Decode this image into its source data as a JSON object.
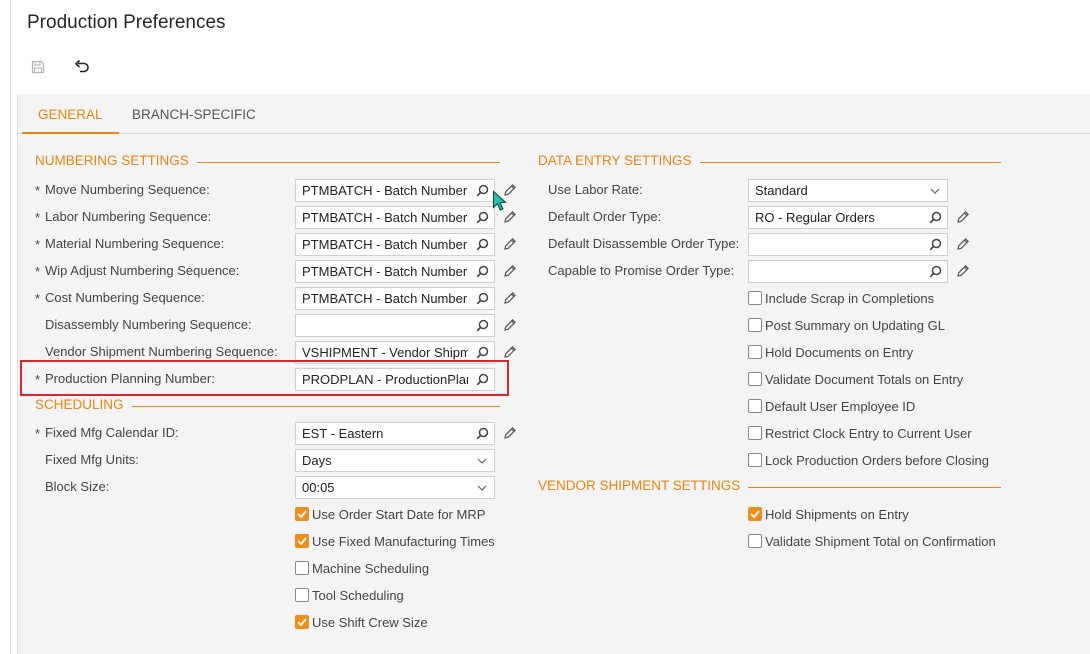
{
  "header": {
    "title": "Production Preferences"
  },
  "toolbar": {
    "save_icon": "save-icon",
    "undo_icon": "undo-icon"
  },
  "tabs": [
    {
      "label": "GENERAL",
      "active": true
    },
    {
      "label": "BRANCH-SPECIFIC",
      "active": false
    }
  ],
  "numbering": {
    "title": "NUMBERING SETTINGS",
    "fields": [
      {
        "label": "Move Numbering Sequence:",
        "required": true,
        "value": "PTMBATCH - Batch Numbering"
      },
      {
        "label": "Labor Numbering Sequence:",
        "required": true,
        "value": "PTMBATCH - Batch Numbering"
      },
      {
        "label": "Material Numbering Sequence:",
        "required": true,
        "value": "PTMBATCH - Batch Numbering"
      },
      {
        "label": "Wip Adjust Numbering Sequence:",
        "required": true,
        "value": "PTMBATCH - Batch Numbering"
      },
      {
        "label": "Cost Numbering Sequence:",
        "required": true,
        "value": "PTMBATCH - Batch Numbering"
      },
      {
        "label": "Disassembly Numbering Sequence:",
        "required": false,
        "value": ""
      },
      {
        "label": "Vendor Shipment Numbering Sequence:",
        "required": false,
        "value": "VSHIPMENT - Vendor Shipment"
      },
      {
        "label": "Production Planning Number:",
        "required": true,
        "value": "PRODPLAN - ProductionPlanning"
      }
    ]
  },
  "scheduling": {
    "title": "SCHEDULING",
    "calendar": {
      "label": "Fixed Mfg Calendar ID:",
      "required": true,
      "value": "EST - Eastern"
    },
    "units": {
      "label": "Fixed Mfg Units:",
      "value": "Days"
    },
    "block": {
      "label": "Block Size:",
      "value": "00:05"
    },
    "checks": [
      {
        "label": "Use Order Start Date for MRP",
        "checked": true
      },
      {
        "label": "Use Fixed Manufacturing Times",
        "checked": true
      },
      {
        "label": "Machine Scheduling",
        "checked": false
      },
      {
        "label": "Tool Scheduling",
        "checked": false
      },
      {
        "label": "Use Shift Crew Size",
        "checked": true
      }
    ]
  },
  "data_entry": {
    "title": "DATA ENTRY SETTINGS",
    "labor_rate": {
      "label": "Use Labor Rate:",
      "value": "Standard"
    },
    "order_type": {
      "label": "Default Order Type:",
      "value": "RO - Regular Orders"
    },
    "disassemble_type": {
      "label": "Default Disassemble Order Type:",
      "value": ""
    },
    "ctp_type": {
      "label": "Capable to Promise Order Type:",
      "value": ""
    },
    "checks": [
      {
        "label": "Include Scrap in Completions",
        "checked": false
      },
      {
        "label": "Post Summary on Updating GL",
        "checked": false
      },
      {
        "label": "Hold Documents on Entry",
        "checked": false
      },
      {
        "label": "Validate Document Totals on Entry",
        "checked": false
      },
      {
        "label": "Default User Employee ID",
        "checked": false
      },
      {
        "label": "Restrict Clock Entry to Current User",
        "checked": false
      },
      {
        "label": "Lock Production Orders before Closing",
        "checked": false
      }
    ]
  },
  "vendor_shipment": {
    "title": "VENDOR SHIPMENT SETTINGS",
    "checks": [
      {
        "label": "Hold Shipments on Entry",
        "checked": true
      },
      {
        "label": "Validate Shipment Total on Confirmation",
        "checked": false
      }
    ]
  },
  "colors": {
    "accent": "#e8860e",
    "highlight": "#d22a2a",
    "checkbox_on": "#ee8d17"
  }
}
